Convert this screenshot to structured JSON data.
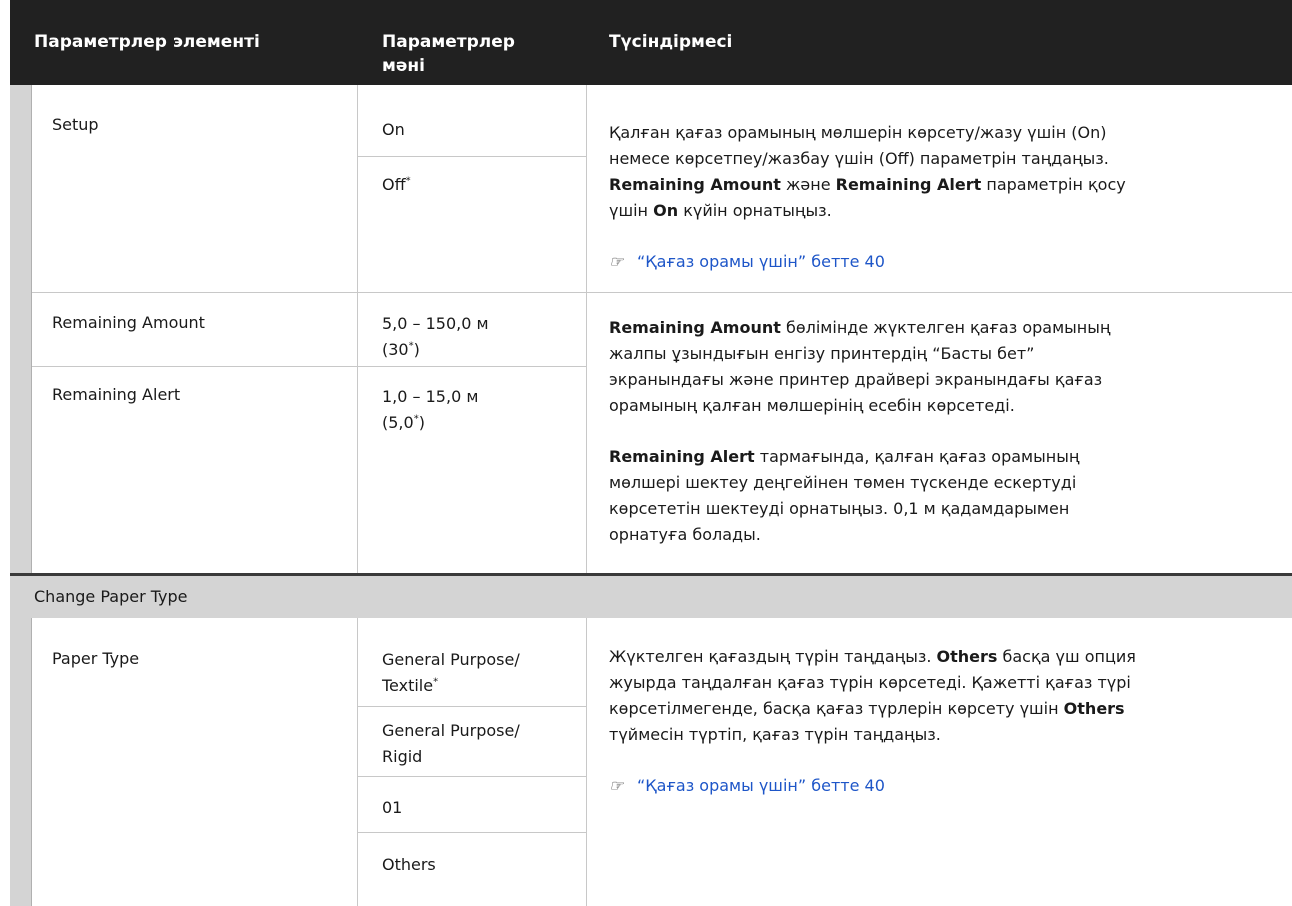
{
  "header": {
    "col1": "Параметрлер элементі",
    "col2_line1": "Параметрлер",
    "col2_line2": "мәні",
    "col3": "Түсіндірмесі"
  },
  "rows": {
    "setup": {
      "label": "Setup",
      "value_on": "On",
      "value_off": "Off",
      "default_mark": "*",
      "desc_line1": "Қалған қағаз орамының мөлшерін көрсету/жазу үшін (On)",
      "desc_line2": "немесе көрсетпеу/жазбау үшін (Off) параметрін таңдаңыз.",
      "desc_b1": "Remaining Amount",
      "desc_t1": " және ",
      "desc_b2": "Remaining Alert",
      "desc_t2": " параметрін қосу",
      "desc_t3": "үшін ",
      "desc_b3": "On",
      "desc_t4": " күйін орнатыңыз.",
      "link": "“Қағаз орамы үшін” бетте 40"
    },
    "remaining_amount": {
      "label": "Remaining Amount",
      "value_line1": "5,0 – 150,0 м",
      "value_line2_pre": "(30",
      "value_line2_post": ")",
      "default_mark": "*",
      "desc_b1": "Remaining Amount",
      "desc_t1": " бөлімінде жүктелген қағаз орамының",
      "desc_line2": "жалпы ұзындығын енгізу принтердің “Басты бет”",
      "desc_line3": "экранындағы және принтер драйвері экранындағы қағаз",
      "desc_line4": "орамының қалған мөлшерінің есебін көрсетеді."
    },
    "remaining_alert": {
      "label": "Remaining Alert",
      "value_line1": "1,0 – 15,0 м",
      "value_line2_pre": "(5,0",
      "value_line2_post": ")",
      "default_mark": "*",
      "desc_b1": "Remaining Alert",
      "desc_t1": " тармағында, қалған қағаз орамының",
      "desc_line2": "мөлшері шектеу деңгейінен төмен түскенде ескертуді",
      "desc_line3": "көрсететін шектеуді орнатыңыз. 0,1 м қадамдарымен",
      "desc_line4": "орнатуға болады."
    },
    "change_paper_type": {
      "label": "Change Paper Type"
    },
    "paper_type": {
      "label": "Paper Type",
      "opt1_line1": "General Purpose/",
      "opt1_line2": "Textile",
      "opt1_mark": "*",
      "opt2_line1": "General Purpose/",
      "opt2_line2": "Rigid",
      "opt3": "01",
      "opt4": "Others",
      "desc_t1": "Жүктелген қағаздың түрін таңдаңыз. ",
      "desc_b1": "Others",
      "desc_t2": " басқа үш опция",
      "desc_line2": "жуырда таңдалған қағаз түрін көрсетеді. Қажетті қағаз түрі",
      "desc_line3_pre": "көрсетілмегенде, басқа қағаз түрлерін көрсету үшін ",
      "desc_line3_b": "Others",
      "desc_line4": "түймесін түртіп, қағаз түрін таңдаңыз.",
      "link": "“Қағаз орамы үшін” бетте 40"
    }
  },
  "icons": {
    "link_icon": "pointing-hand-icon"
  }
}
